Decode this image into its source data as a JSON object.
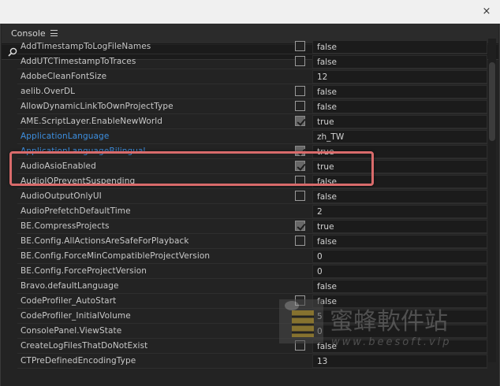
{
  "window": {
    "close_glyph": "×"
  },
  "panel": {
    "title": "Console"
  },
  "search": {
    "value": "",
    "placeholder": ""
  },
  "rows": [
    {
      "name": "AddTimestampToLogFileNames",
      "has_checkbox": true,
      "checked": false,
      "value": "false",
      "link": false
    },
    {
      "name": "AddUTCTimestampToTraces",
      "has_checkbox": true,
      "checked": false,
      "value": "false",
      "link": false
    },
    {
      "name": "AdobeCleanFontSize",
      "has_checkbox": false,
      "checked": false,
      "value": "12",
      "link": false
    },
    {
      "name": "aelib.OverDL",
      "has_checkbox": true,
      "checked": false,
      "value": "false",
      "link": false
    },
    {
      "name": "AllowDynamicLinkToOwnProjectType",
      "has_checkbox": true,
      "checked": false,
      "value": "false",
      "link": false
    },
    {
      "name": "AME.ScriptLayer.EnableNewWorld",
      "has_checkbox": true,
      "checked": true,
      "value": "true",
      "link": false
    },
    {
      "name": "ApplicationLanguage",
      "has_checkbox": false,
      "checked": false,
      "value": "zh_TW",
      "link": true
    },
    {
      "name": "ApplicationLanguageBilingual",
      "has_checkbox": true,
      "checked": true,
      "value": "true",
      "link": true
    },
    {
      "name": "AudioAsioEnabled",
      "has_checkbox": true,
      "checked": true,
      "value": "true",
      "link": false
    },
    {
      "name": "AudioIOPreventSuspending",
      "has_checkbox": true,
      "checked": false,
      "value": "false",
      "link": false
    },
    {
      "name": "AudioOutputOnlyUI",
      "has_checkbox": true,
      "checked": false,
      "value": "false",
      "link": false
    },
    {
      "name": "AudioPrefetchDefaultTime",
      "has_checkbox": false,
      "checked": false,
      "value": "2",
      "link": false
    },
    {
      "name": "BE.CompressProjects",
      "has_checkbox": true,
      "checked": true,
      "value": "true",
      "link": false
    },
    {
      "name": "BE.Config.AllActionsAreSafeForPlayback",
      "has_checkbox": true,
      "checked": false,
      "value": "false",
      "link": false
    },
    {
      "name": "BE.Config.ForceMinCompatibleProjectVersion",
      "has_checkbox": false,
      "checked": false,
      "value": "0",
      "link": false
    },
    {
      "name": "BE.Config.ForceProjectVersion",
      "has_checkbox": false,
      "checked": false,
      "value": "0",
      "link": false
    },
    {
      "name": "Bravo.defaultLanguage",
      "has_checkbox": false,
      "checked": false,
      "value": "false",
      "link": false
    },
    {
      "name": "CodeProfiler_AutoStart",
      "has_checkbox": true,
      "checked": false,
      "value": "false",
      "link": false
    },
    {
      "name": "CodeProfiler_InitialVolume",
      "has_checkbox": false,
      "checked": false,
      "value": "5",
      "link": false
    },
    {
      "name": "ConsolePanel.ViewState",
      "has_checkbox": false,
      "checked": false,
      "value": "0",
      "link": false
    },
    {
      "name": "CreateLogFilesThatDoNotExist",
      "has_checkbox": true,
      "checked": false,
      "value": "false",
      "link": false
    },
    {
      "name": "CTPreDefinedEncodingType",
      "has_checkbox": false,
      "checked": false,
      "value": "13",
      "link": false
    }
  ],
  "watermark": {
    "brand": "蜜蜂軟件站",
    "url": "www.beesoft.vip"
  },
  "colors": {
    "link": "#3d8fe0",
    "highlight": "#d96b6b",
    "background": "#232323"
  }
}
